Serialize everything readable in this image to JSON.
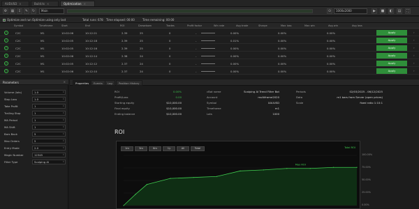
{
  "tabs": [
    {
      "label": "AUDUSD",
      "active": false
    },
    {
      "label": "Build.ts",
      "active": false
    },
    {
      "label": "Optimization",
      "active": true
    }
  ],
  "toolbar": {
    "strategy_select": "Main",
    "zoom_select": "1000x2000",
    "progress_fraction": 1.0
  },
  "status": {
    "checkbox_label": "Optimize and run Optimize using only last",
    "items": [
      "Total runs: 678",
      "Time elapsed: 00:00",
      "Time remaining: 00:00"
    ]
  },
  "table": {
    "headers": [
      "",
      "Symbol",
      "Timeframe",
      "Start",
      "End",
      "ROI",
      "Drawdown",
      "Trades",
      "Profit factor",
      "Win rate",
      "Avg trade",
      "Sharpe",
      "Max loss",
      "Max win",
      "Avg win",
      "Avg loss",
      ""
    ],
    "rows": [
      {
        "sym": "C2C",
        "tf": "M1",
        "start": "10:02:06",
        "end": "10:12:21",
        "roi": "2.39",
        "dd": "25",
        "trades": "0",
        "pf": "-",
        "wr": "0.00%",
        "at": "0.00%",
        "sh": "0.00%",
        "apply": "Apply"
      },
      {
        "sym": "C2C",
        "tf": "M1",
        "start": "10:02:05",
        "end": "10:12:18",
        "roi": "2.39",
        "dd": "25",
        "trades": "0",
        "pf": "-",
        "wr": "0.01%",
        "at": "0.00%",
        "sh": "0.00%",
        "apply": "Apply"
      },
      {
        "sym": "C2C",
        "tf": "M1",
        "start": "10:02:05",
        "end": "10:12:16",
        "roi": "2.39",
        "dd": "25",
        "trades": "0",
        "pf": "-",
        "wr": "0.00%",
        "at": "0.00%",
        "sh": "0.00%",
        "apply": "Apply"
      },
      {
        "sym": "C2C",
        "tf": "M1",
        "start": "10:02:06",
        "end": "10:12:14",
        "roi": "2.38",
        "dd": "24",
        "trades": "0",
        "pf": "-",
        "wr": "0.00%",
        "at": "0.00%",
        "sh": "0.00%",
        "apply": "Apply"
      },
      {
        "sym": "C2C",
        "tf": "M1",
        "start": "10:02:05",
        "end": "10:12:12",
        "roi": "2.37",
        "dd": "24",
        "trades": "0",
        "pf": "-",
        "wr": "0.00%",
        "at": "0.00%",
        "sh": "0.00%",
        "apply": "Apply"
      },
      {
        "sym": "C2C",
        "tf": "M1",
        "start": "10:02:06",
        "end": "10:12:10",
        "roi": "2.37",
        "dd": "24",
        "trades": "0",
        "pf": "-",
        "wr": "0.00%",
        "at": "0.00%",
        "sh": "0.00%",
        "apply": "Apply"
      }
    ]
  },
  "params": {
    "header": "Parameters",
    "items": [
      {
        "label": "Volume (lots)",
        "value": "1.0"
      },
      {
        "label": "Stop Loss",
        "value": "1.0"
      },
      {
        "label": "Take Profit",
        "value": "1"
      },
      {
        "label": "Trailing Stop",
        "value": "1"
      },
      {
        "label": "MA Period",
        "value": "1"
      },
      {
        "label": "MA Shift",
        "value": "1"
      },
      {
        "label": "Bars Back",
        "value": "5"
      },
      {
        "label": "Max Orders",
        "value": "5"
      },
      {
        "label": "Entry Mode",
        "value": "2.0"
      },
      {
        "label": "Magic Number",
        "value": "12345"
      },
      {
        "label": "Filter Type",
        "value": "Scalping AI"
      }
    ]
  },
  "right_tabs": [
    "Properties",
    "Events",
    "Log",
    "Position History"
  ],
  "stats_left": [
    {
      "label": "ROI",
      "value": "0.00%",
      "green": true
    },
    {
      "label": "Profit/Loss",
      "value": "0.00",
      "green": true
    },
    {
      "label": "Starting equity",
      "value": "$10,000.00",
      "green": false
    },
    {
      "label": "Final equity",
      "value": "$10,000.00",
      "green": false
    },
    {
      "label": "Ending balance",
      "value": "$10,000.00",
      "green": false
    }
  ],
  "stats_mid": [
    {
      "label": "cBot name",
      "value": "Scalping AI Trend Filter Bot"
    },
    {
      "label": "Account",
      "value": "multiframe2020"
    },
    {
      "label": "Symbol",
      "value": "XAUUSD"
    },
    {
      "label": "Timeframe",
      "value": "m1"
    },
    {
      "label": "Lots",
      "value": "1000"
    }
  ],
  "stats_right": [
    {
      "label": "Periods",
      "value": "02/03/2025 - 06/12/2025"
    },
    {
      "label": "Data",
      "value": "m1 bars from Server (open prices)"
    },
    {
      "label": "Scale",
      "value": "fixed ratio 1:10:1"
    }
  ],
  "chart_title": "ROI",
  "ranges": [
    "1m",
    "3m",
    "6m",
    "1y",
    "All",
    "Total"
  ],
  "chart_data": {
    "type": "area",
    "title": "ROI",
    "x": [
      0,
      5,
      10,
      20,
      30,
      40,
      50,
      60,
      70,
      80,
      90,
      100
    ],
    "values": [
      0,
      22,
      42,
      54,
      56,
      58,
      69,
      71,
      74,
      74,
      76,
      76
    ],
    "ylim": [
      0,
      100
    ],
    "yticks": [
      "100.00%",
      "75.00%",
      "50.00%",
      "25.00%",
      "0.00%"
    ],
    "annotation": "Max ROI",
    "legend": "Total ROI",
    "line_color": "#3fcc4f",
    "fill_color": "#0f2e14"
  }
}
